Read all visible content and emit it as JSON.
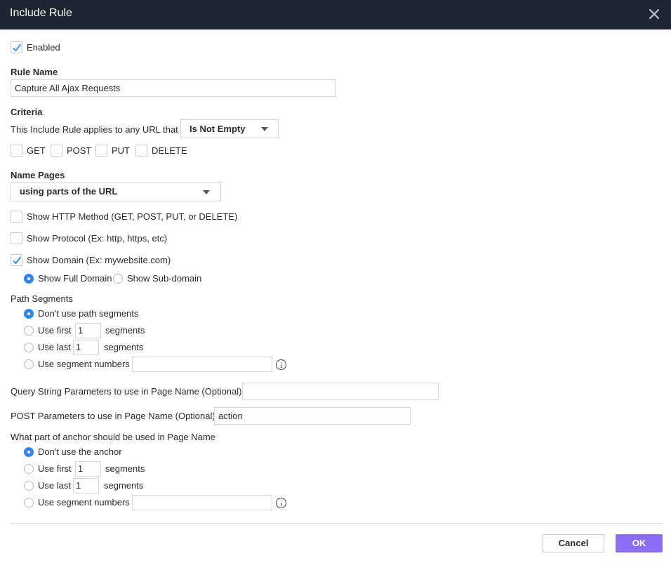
{
  "dialog": {
    "title": "Include Rule"
  },
  "enabled": {
    "label": "Enabled",
    "checked": true
  },
  "rule_name": {
    "label": "Rule Name",
    "value": "Capture All Ajax Requests"
  },
  "criteria": {
    "label": "Criteria",
    "applies_text": "This Include Rule applies to any URL that",
    "condition": "Is Not Empty",
    "methods": [
      {
        "label": "GET",
        "checked": false
      },
      {
        "label": "POST",
        "checked": false
      },
      {
        "label": "PUT",
        "checked": false
      },
      {
        "label": "DELETE",
        "checked": false
      }
    ]
  },
  "name_pages": {
    "label": "Name Pages",
    "method": "using parts of the URL",
    "options": [
      {
        "label": "Show HTTP Method (GET, POST, PUT, or DELETE)",
        "checked": false
      },
      {
        "label": "Show Protocol (Ex: http, https, etc)",
        "checked": false
      },
      {
        "label": "Show Domain (Ex: mywebsite.com)",
        "checked": true
      }
    ],
    "domain_options": [
      {
        "label": "Show Full Domain",
        "selected": true
      },
      {
        "label": "Show Sub-domain",
        "selected": false
      }
    ]
  },
  "path_segments": {
    "label": "Path Segments",
    "none_label": "Don't use path segments",
    "use_first_label": "Use first",
    "use_first_value": "1",
    "use_last_label": "Use last",
    "use_last_value": "1",
    "segments_label": "segments",
    "numbers_label": "Use segment numbers",
    "numbers_value": "",
    "selected": "none"
  },
  "query_params": {
    "label": "Query String Parameters to use in Page Name (Optional)",
    "value": ""
  },
  "post_params": {
    "label": "POST Parameters to use in Page Name (Optional)",
    "value": "action"
  },
  "anchor": {
    "label": "What part of anchor should be used in Page Name",
    "none_label": "Don't use the anchor",
    "use_first_label": "Use first",
    "use_first_value": "1",
    "use_last_label": "Use last",
    "use_last_value": "1",
    "segments_label": "segments",
    "numbers_label": "Use segment numbers",
    "numbers_value": "",
    "selected": "none"
  },
  "footer": {
    "cancel_label": "Cancel",
    "ok_label": "OK"
  },
  "colors": {
    "titlebar": "#1d2632",
    "accent": "#2f86f6",
    "ok_button": "#8a6cf7"
  },
  "icons": {
    "close": "close-icon",
    "check": "checkmark-icon",
    "info": "info-icon",
    "caret": "chevron-down-icon"
  }
}
